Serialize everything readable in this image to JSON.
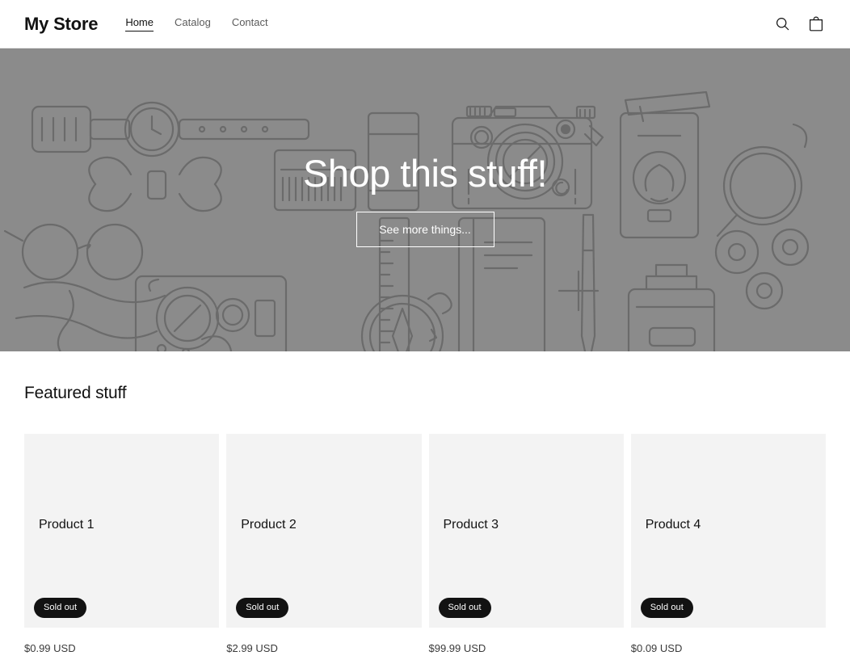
{
  "header": {
    "logo": "My Store",
    "nav": [
      {
        "label": "Home",
        "active": true
      },
      {
        "label": "Catalog",
        "active": false
      },
      {
        "label": "Contact",
        "active": false
      }
    ],
    "search_icon": "search-icon",
    "cart_icon": "shopping-cart-icon"
  },
  "hero": {
    "title": "Shop this stuff!",
    "button_label": "See more things...",
    "background_color": "#8b8b8b",
    "line_art_color": "#6b6b6b"
  },
  "featured": {
    "title": "Featured stuff",
    "products": [
      {
        "title": "Product 1",
        "badge": "Sold out",
        "price": "$0.99 USD"
      },
      {
        "title": "Product 2",
        "badge": "Sold out",
        "price": "$2.99 USD"
      },
      {
        "title": "Product 3",
        "badge": "Sold out",
        "price": "$99.99 USD"
      },
      {
        "title": "Product 4",
        "badge": "Sold out",
        "price": "$0.09 USD"
      }
    ]
  },
  "colors": {
    "text": "#121212",
    "muted_text": "#5b5b5b",
    "card_bg": "#f3f3f3",
    "badge_bg": "#121212"
  }
}
